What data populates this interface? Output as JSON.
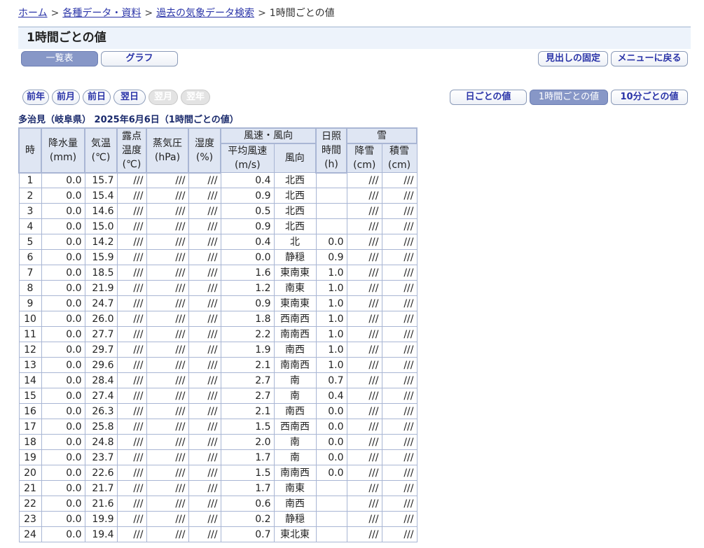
{
  "breadcrumb": {
    "home": "ホーム",
    "data": "各種データ・資料",
    "search": "過去の気象データ検索",
    "current": "1時間ごとの値",
    "sep": ">"
  },
  "page_title": "1時間ごとの値",
  "buttons": {
    "list": "一覧表",
    "graph": "グラフ",
    "fix_header": "見出しの固定",
    "back_menu": "メニューに戻る",
    "prev_year": "前年",
    "prev_month": "前月",
    "prev_day": "前日",
    "next_day": "翌日",
    "next_month": "翌月",
    "next_year": "翌年",
    "daily": "日ごとの値",
    "hourly": "1時間ごとの値",
    "ten_min": "10分ごとの値"
  },
  "station_title": "多治見（岐阜県） 2025年6月6日（1時間ごとの値）",
  "table": {
    "headers": {
      "hour": "時",
      "precip": "降水量",
      "precip_unit": "(mm)",
      "temp": "気温",
      "temp_unit": "(℃)",
      "dew1": "露点",
      "dew2": "温度",
      "dew_unit": "(℃)",
      "vapor": "蒸気圧",
      "vapor_unit": "(hPa)",
      "humidity": "湿度",
      "humidity_unit": "(%)",
      "wind": "風速・風向",
      "wind_speed": "平均風速",
      "wind_speed_unit": "(m/s)",
      "wind_dir": "風向",
      "sun1": "日照",
      "sun2": "時間",
      "sun_unit": "(h)",
      "snow": "雪",
      "snowfall": "降雪",
      "snowfall_unit": "(cm)",
      "snowdepth": "積雪",
      "snowdepth_unit": "(cm)"
    },
    "rows": [
      [
        "1",
        "0.0",
        "15.7",
        "///",
        "///",
        "///",
        "0.4",
        "北西",
        "",
        "///",
        "///"
      ],
      [
        "2",
        "0.0",
        "15.4",
        "///",
        "///",
        "///",
        "0.9",
        "北西",
        "",
        "///",
        "///"
      ],
      [
        "3",
        "0.0",
        "14.6",
        "///",
        "///",
        "///",
        "0.5",
        "北西",
        "",
        "///",
        "///"
      ],
      [
        "4",
        "0.0",
        "15.0",
        "///",
        "///",
        "///",
        "0.9",
        "北西",
        "",
        "///",
        "///"
      ],
      [
        "5",
        "0.0",
        "14.2",
        "///",
        "///",
        "///",
        "0.4",
        "北",
        "0.0",
        "///",
        "///"
      ],
      [
        "6",
        "0.0",
        "15.9",
        "///",
        "///",
        "///",
        "0.0",
        "静穏",
        "0.9",
        "///",
        "///"
      ],
      [
        "7",
        "0.0",
        "18.5",
        "///",
        "///",
        "///",
        "1.6",
        "東南東",
        "1.0",
        "///",
        "///"
      ],
      [
        "8",
        "0.0",
        "21.9",
        "///",
        "///",
        "///",
        "1.2",
        "南東",
        "1.0",
        "///",
        "///"
      ],
      [
        "9",
        "0.0",
        "24.7",
        "///",
        "///",
        "///",
        "0.9",
        "東南東",
        "1.0",
        "///",
        "///"
      ],
      [
        "10",
        "0.0",
        "26.0",
        "///",
        "///",
        "///",
        "1.8",
        "西南西",
        "1.0",
        "///",
        "///"
      ],
      [
        "11",
        "0.0",
        "27.7",
        "///",
        "///",
        "///",
        "2.2",
        "南南西",
        "1.0",
        "///",
        "///"
      ],
      [
        "12",
        "0.0",
        "29.7",
        "///",
        "///",
        "///",
        "1.9",
        "南西",
        "1.0",
        "///",
        "///"
      ],
      [
        "13",
        "0.0",
        "29.6",
        "///",
        "///",
        "///",
        "2.1",
        "南南西",
        "1.0",
        "///",
        "///"
      ],
      [
        "14",
        "0.0",
        "28.4",
        "///",
        "///",
        "///",
        "2.7",
        "南",
        "0.7",
        "///",
        "///"
      ],
      [
        "15",
        "0.0",
        "27.4",
        "///",
        "///",
        "///",
        "2.7",
        "南",
        "0.4",
        "///",
        "///"
      ],
      [
        "16",
        "0.0",
        "26.3",
        "///",
        "///",
        "///",
        "2.1",
        "南西",
        "0.0",
        "///",
        "///"
      ],
      [
        "17",
        "0.0",
        "25.8",
        "///",
        "///",
        "///",
        "1.5",
        "西南西",
        "0.0",
        "///",
        "///"
      ],
      [
        "18",
        "0.0",
        "24.8",
        "///",
        "///",
        "///",
        "2.0",
        "南",
        "0.0",
        "///",
        "///"
      ],
      [
        "19",
        "0.0",
        "23.7",
        "///",
        "///",
        "///",
        "1.7",
        "南",
        "0.0",
        "///",
        "///"
      ],
      [
        "20",
        "0.0",
        "22.6",
        "///",
        "///",
        "///",
        "1.5",
        "南南西",
        "0.0",
        "///",
        "///"
      ],
      [
        "21",
        "0.0",
        "21.7",
        "///",
        "///",
        "///",
        "1.7",
        "南東",
        "",
        "///",
        "///"
      ],
      [
        "22",
        "0.0",
        "21.6",
        "///",
        "///",
        "///",
        "0.6",
        "南西",
        "",
        "///",
        "///"
      ],
      [
        "23",
        "0.0",
        "19.9",
        "///",
        "///",
        "///",
        "0.2",
        "静穏",
        "",
        "///",
        "///"
      ],
      [
        "24",
        "0.0",
        "19.4",
        "///",
        "///",
        "///",
        "0.7",
        "東北東",
        "",
        "///",
        "///"
      ]
    ]
  }
}
